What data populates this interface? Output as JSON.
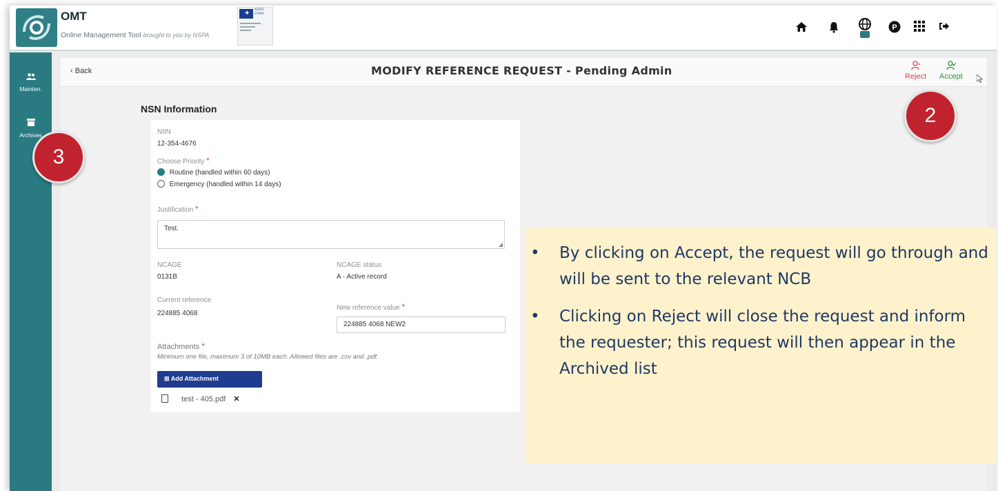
{
  "header": {
    "app_name": "OMT",
    "app_subtitle": "Online Management Tool",
    "app_tagline": "brought to you by NSPA",
    "nato_badge": "NATO OTAN",
    "icons": [
      "home-icon",
      "bell-icon",
      "globe-icon",
      "parking-icon",
      "grid-icon",
      "logout-icon"
    ]
  },
  "sidebar": {
    "items": [
      {
        "label": "Mainten.",
        "icon": "users-icon"
      },
      {
        "label": "Archives",
        "icon": "archive-icon"
      }
    ]
  },
  "topbar": {
    "back_label": "Back",
    "title": "MODIFY REFERENCE REQUEST - Pending Admin",
    "reject_label": "Reject",
    "accept_label": "Accept"
  },
  "form": {
    "section_title": "NSN Information",
    "niin_label": "NIIN",
    "niin_value": "12-354-4676",
    "priority_label": "Choose Priority",
    "priority_options": [
      {
        "label": "Routine (handled within 60 days)",
        "selected": true
      },
      {
        "label": "Emergency (handled within 14 days)",
        "selected": false
      }
    ],
    "justification_label": "Justification",
    "justification_value": "Test.",
    "ncage_label": "NCAGE",
    "ncage_value": "0131B",
    "ncage_status_label": "NCAGE status",
    "ncage_status_value": "A - Active record",
    "current_ref_label": "Current reference",
    "current_ref_value": "224885 4068",
    "new_ref_label": "New reference value",
    "new_ref_value": "224885 4068 NEW2",
    "attachments_label": "Attachments",
    "attachments_hint": "Minimum one file, maximum 3 of 10MB each. Allowed files are .csv and .pdf.",
    "add_attachment_label": "Add Attachment",
    "file_name": "test - 405.pdf"
  },
  "annotations": {
    "badge_2": "2",
    "badge_3": "3",
    "bullets": [
      "By clicking on Accept, the request will go through and  will be sent to the relevant NCB",
      "Clicking on Reject will close the request and inform the requester; this request will then appear in the Archived list"
    ]
  },
  "colors": {
    "teal": "#2a7a82",
    "reject": "#d4464e",
    "accept": "#2f8a3a",
    "button_blue": "#1f3c8f",
    "badge_red": "#c0232e",
    "callout_bg": "#fdf2cc",
    "callout_text": "#203864"
  }
}
